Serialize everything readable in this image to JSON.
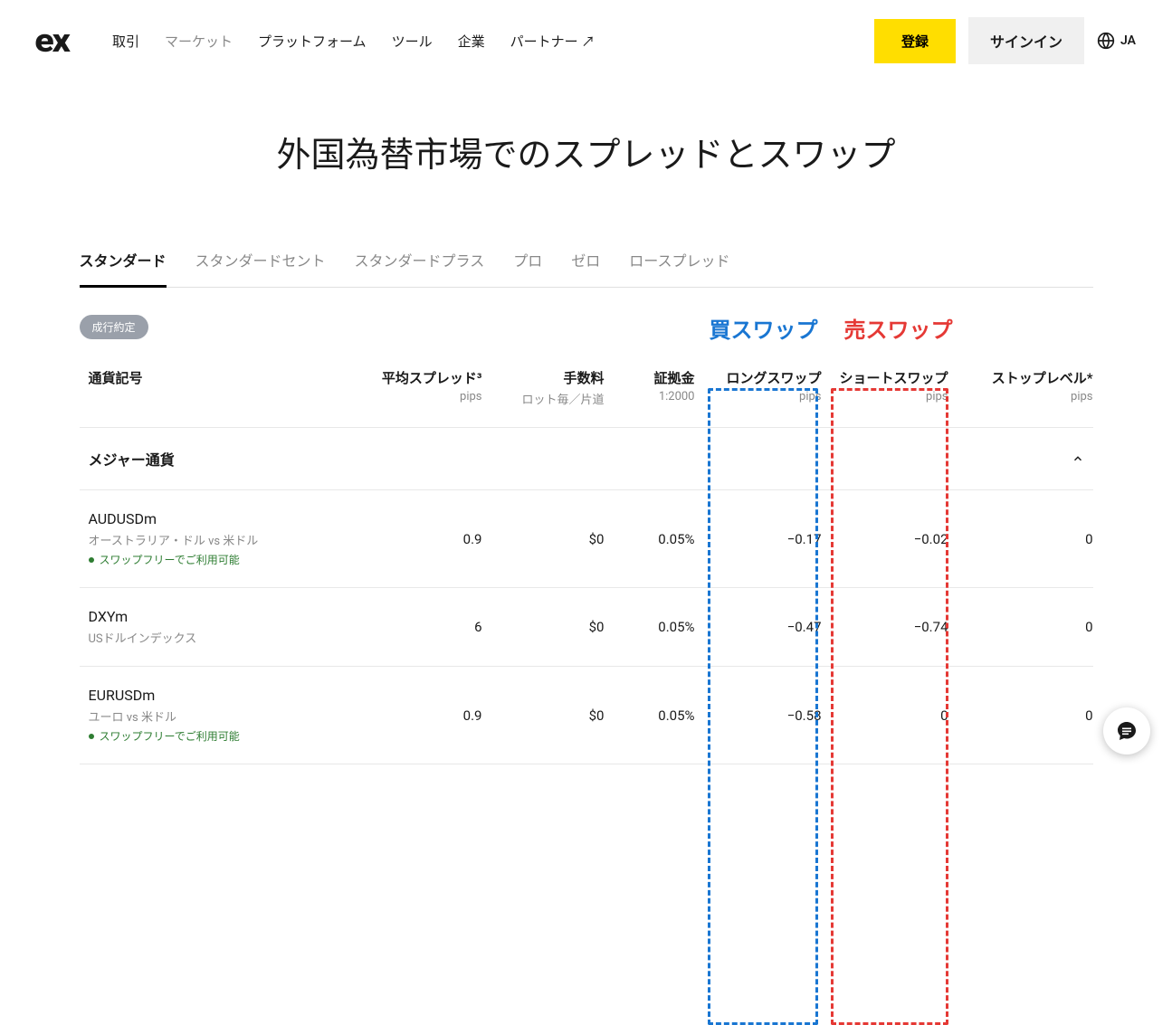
{
  "header": {
    "logo": "ex",
    "nav": [
      {
        "label": "取引",
        "muted": false
      },
      {
        "label": "マーケット",
        "muted": true
      },
      {
        "label": "プラットフォーム",
        "muted": false
      },
      {
        "label": "ツール",
        "muted": false
      },
      {
        "label": "企業",
        "muted": false
      },
      {
        "label": "パートナー ↗",
        "muted": false
      }
    ],
    "register": "登録",
    "signin": "サインイン",
    "lang": "JA"
  },
  "page_title": "外国為替市場でのスプレッドとスワップ",
  "tabs": [
    {
      "label": "スタンダード",
      "active": true
    },
    {
      "label": "スタンダードセント",
      "active": false
    },
    {
      "label": "スタンダードプラス",
      "active": false
    },
    {
      "label": "プロ",
      "active": false
    },
    {
      "label": "ゼロ",
      "active": false
    },
    {
      "label": "ロースプレッド",
      "active": false
    }
  ],
  "badge": "成行約定",
  "callouts": {
    "buy": "買スワップ",
    "sell": "売スワップ"
  },
  "columns": [
    {
      "title": "通貨記号",
      "sub": "",
      "align": "left"
    },
    {
      "title": "平均スプレッド³",
      "sub": "pips",
      "align": "right"
    },
    {
      "title": "手数料",
      "sub": "ロット毎／片道",
      "align": "right"
    },
    {
      "title": "証拠金",
      "sub": "1:2000",
      "align": "right"
    },
    {
      "title": "ロングスワップ",
      "sub": "pips",
      "align": "right"
    },
    {
      "title": "ショートスワップ",
      "sub": "pips",
      "align": "right"
    },
    {
      "title": "ストップレベル*",
      "sub": "pips",
      "align": "right"
    }
  ],
  "section_title": "メジャー通貨",
  "rows": [
    {
      "symbol": "AUDUSDm",
      "desc": "オーストラリア・ドル vs 米ドル",
      "swap_free": "スワップフリーでご利用可能",
      "spread": "0.9",
      "fee": "$0",
      "margin": "0.05%",
      "long_swap": "−0.17",
      "short_swap": "−0.02",
      "stop": "0"
    },
    {
      "symbol": "DXYm",
      "desc": "USドルインデックス",
      "swap_free": "",
      "spread": "6",
      "fee": "$0",
      "margin": "0.05%",
      "long_swap": "−0.47",
      "short_swap": "−0.74",
      "stop": "0"
    },
    {
      "symbol": "EURUSDm",
      "desc": "ユーロ vs 米ドル",
      "swap_free": "スワップフリーでご利用可能",
      "spread": "0.9",
      "fee": "$0",
      "margin": "0.05%",
      "long_swap": "−0.58",
      "short_swap": "0",
      "stop": "0"
    }
  ]
}
